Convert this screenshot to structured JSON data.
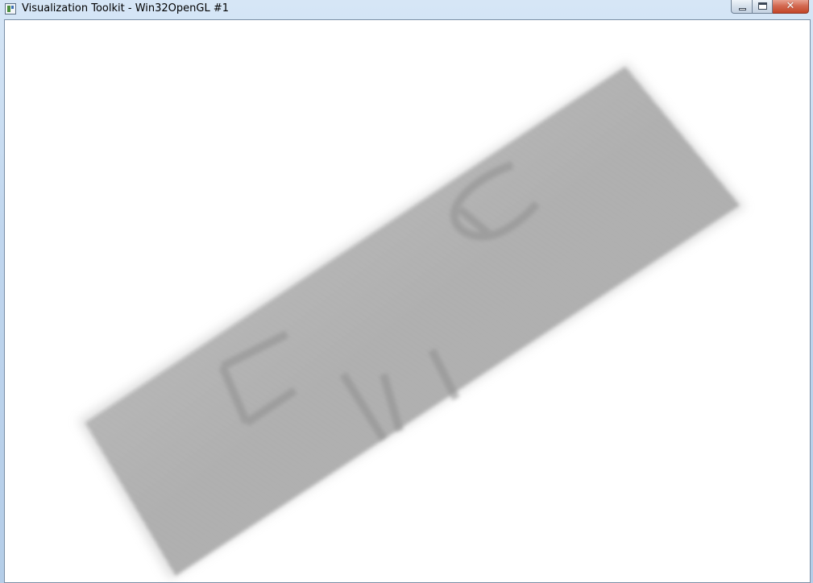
{
  "window": {
    "title": "Visualization Toolkit - Win32OpenGL #1",
    "close_glyph": "✕",
    "icons": {
      "app": "vtk-window-icon",
      "minimize": "minimize-icon",
      "maximize": "maximize-icon",
      "close": "close-icon"
    }
  },
  "viewport": {
    "background_color": "#ffffff",
    "volume_color": "#b9b9b9",
    "volume_dark_color": "#8f8f8f",
    "content": "volume-rendered-slab"
  }
}
